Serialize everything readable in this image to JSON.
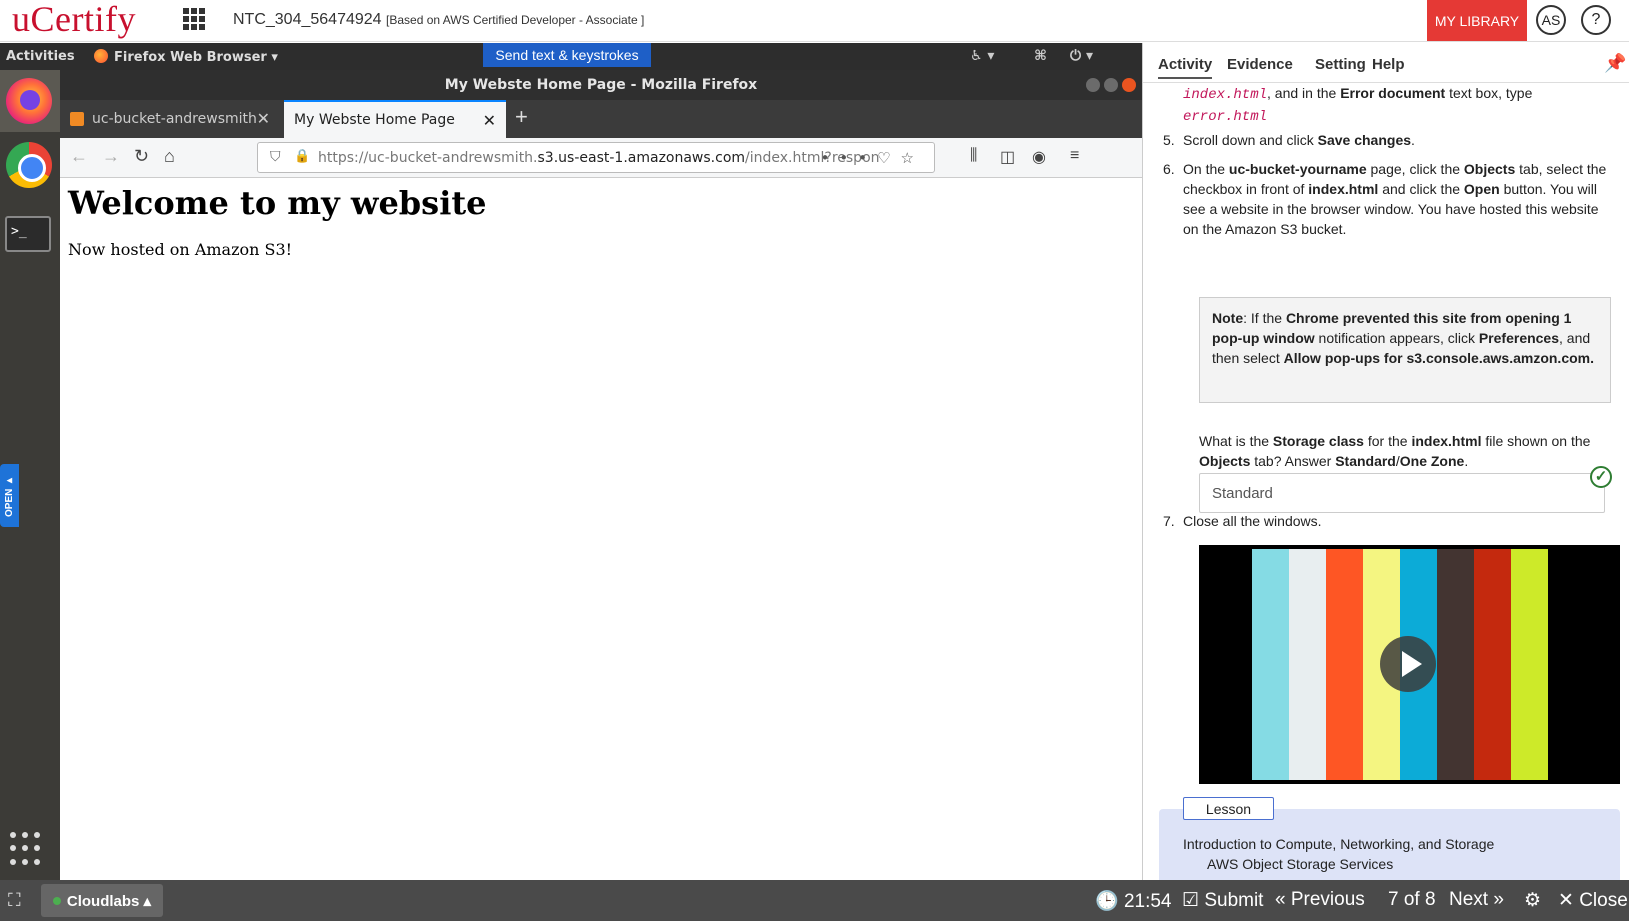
{
  "header": {
    "logo": "uCertify",
    "course_id": "NTC_304_56474924",
    "course_sub": "[Based on AWS Certified Developer - Associate ]",
    "my_library": "MY LIBRARY",
    "avatar": "AS",
    "help": "?"
  },
  "desktop": {
    "activities": "Activities",
    "app_menu": "Firefox Web Browser ▾",
    "send_keys": "Send text & keystrokes",
    "open_tab": "OPEN ▸",
    "window_title": "My Webste Home Page - Mozilla Firefox",
    "tabs": [
      {
        "label": "uc-bucket-andrewsmith -"
      },
      {
        "label": "My Webste Home Page"
      }
    ],
    "url_prefix": "https://uc-bucket-andrewsmith.",
    "url_host": "s3.us-east-1.amazonaws.com",
    "url_suffix": "/index.html?respon",
    "page_heading": "Welcome to my website",
    "page_text": "Now hosted on Amazon S3!",
    "icons": [
      "firefox-icon",
      "chrome-icon",
      "terminal-icon",
      "show-apps-icon"
    ]
  },
  "panel": {
    "tabs": [
      "Activity",
      "Evidence",
      "Setting",
      "Help"
    ],
    "step4_code1": "index.html",
    "step4_mid": ", and in the ",
    "step4_bold": "Error document",
    "step4_tail": " text box, type",
    "step4_code2": "error.html",
    "step5_num": "5.",
    "step5_text": "Scroll down and click ",
    "step5_bold": "Save changes",
    "step5_end": ".",
    "step6_num": "6.",
    "step6_a": "On the ",
    "step6_b": "uc-bucket-yourname",
    "step6_c": " page, click the ",
    "step6_d": "Objects",
    "step6_e": " tab, select the checkbox in front of ",
    "step6_f": "index.html",
    "step6_g": " and click the ",
    "step6_h": "Open",
    "step6_i": " button. You will see a website in the browser window. You have hosted this website on the Amazon S3 bucket.",
    "note_label": "Note",
    "note_a": ": If the ",
    "note_b": "Chrome prevented this site from opening 1 pop-up window",
    "note_c": " notification appears, click ",
    "note_d": "Preferences",
    "note_e": ", and then select ",
    "note_f": "Allow pop-ups for s3.console.aws.amzon.com.",
    "q_a": "What is the ",
    "q_b": "Storage class",
    "q_c": " for the ",
    "q_d": "index.html",
    "q_e": " file shown on the ",
    "q_f": "Objects",
    "q_g": " tab? Answer ",
    "q_h": "Standard",
    "q_i": "/",
    "q_j": "One Zone",
    "q_k": ".",
    "answer": "Standard",
    "step7_num": "7.",
    "step7_text": "Close all the windows.",
    "video_bars": [
      "#85dbe4",
      "#e8eef0",
      "#fe5624",
      "#f4f581",
      "#0cabd7",
      "#433431",
      "#c4290e",
      "#cdea29"
    ],
    "lesson_label": "Lesson",
    "lesson_line1": "Introduction to Compute, Networking, and Storage",
    "lesson_line2": "AWS Object Storage Services"
  },
  "footer": {
    "cloudlabs": "Cloudlabs ▴",
    "timer": "21:54",
    "submit": "Submit",
    "previous": "Previous",
    "page": "7 of 8",
    "next": "Next",
    "close": "Close"
  }
}
